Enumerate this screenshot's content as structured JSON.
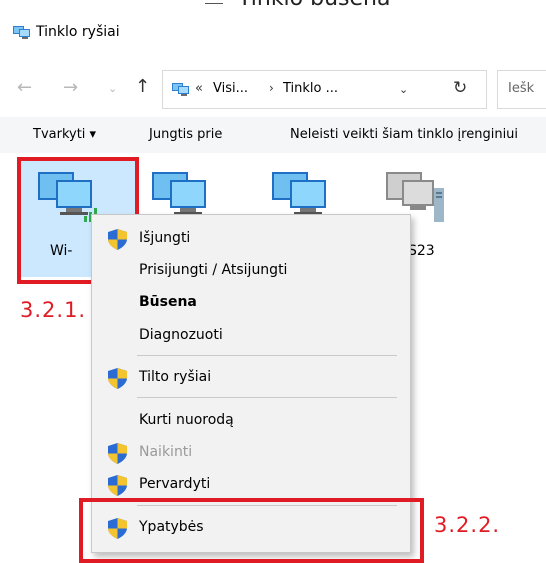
{
  "top_cutoff_text": "Tinklo būsena",
  "window": {
    "title": "Tinklo ryšiai"
  },
  "nav": {
    "back_glyph": "←",
    "forward_glyph": "→",
    "recent_glyph": "⌄",
    "up_glyph": "↑"
  },
  "address": {
    "icon": "network-connections-icon",
    "overflow": "«",
    "segment1": "Visi...",
    "arrow": "›",
    "segment2": "Tinklo ...",
    "dropdown_glyph": "⌄",
    "refresh_glyph": "↻"
  },
  "search": {
    "placeholder": "Iešk"
  },
  "commands": {
    "organize": "Tvarkyti ▾",
    "connect": "Jungtis prie",
    "disable": "Neleisti veikti šiam tinklo įrenginiui"
  },
  "items": [
    {
      "label": "Wi-"
    },
    {
      "label": ""
    },
    {
      "label": ""
    },
    {
      "label": "S23"
    }
  ],
  "annotations": {
    "first": "3.2.1.",
    "second": "3.2.2."
  },
  "context_menu": {
    "items": [
      {
        "label": "Išjungti",
        "shield": true,
        "disabled": false
      },
      {
        "label": "Prisijungti / Atsijungti",
        "shield": false,
        "disabled": false
      },
      {
        "label": "Būsena",
        "shield": false,
        "bold": true
      },
      {
        "label": "Diagnozuoti",
        "shield": false
      },
      {
        "label": "Tilto ryšiai",
        "shield": true
      },
      {
        "label": "Kurti nuorodą",
        "shield": false
      },
      {
        "label": "Naikinti",
        "shield": true,
        "disabled": true
      },
      {
        "label": "Pervardyti",
        "shield": true
      },
      {
        "label": "Ypatybės",
        "shield": true
      }
    ]
  },
  "colors": {
    "selection": "#cce8ff",
    "annotation_red": "#e01b24",
    "menu_bg": "#f2f2f2",
    "shield_blue": "#2b6cd4",
    "shield_yellow": "#f4c430"
  }
}
